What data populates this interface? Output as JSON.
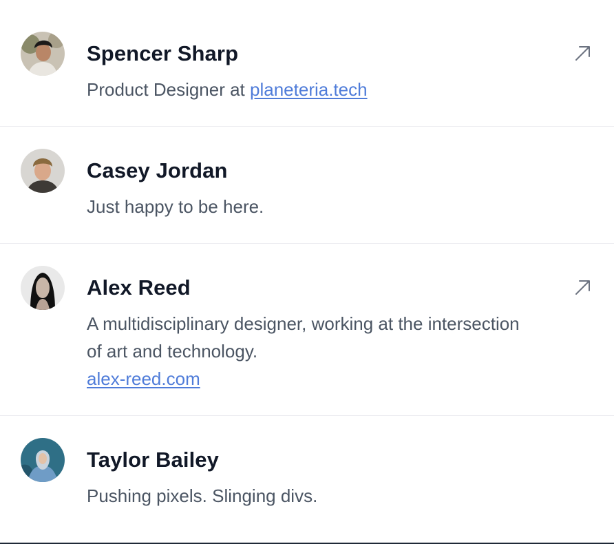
{
  "people": [
    {
      "name": "Spencer Sharp",
      "bio_prefix": "Product Designer at ",
      "bio_link": "planeteria.tech",
      "avatar_icon": "avatar-spencer",
      "has_external_link": true
    },
    {
      "name": "Casey Jordan",
      "bio": "Just happy to be here.",
      "avatar_icon": "avatar-casey",
      "has_external_link": false
    },
    {
      "name": "Alex Reed",
      "bio": "A multidisciplinary designer, working at the intersection of art and technology.",
      "bio_link": "alex-reed.com",
      "avatar_icon": "avatar-alex",
      "has_external_link": true
    },
    {
      "name": "Taylor Bailey",
      "bio": "Pushing pixels. Slinging divs.",
      "avatar_icon": "avatar-taylor",
      "has_external_link": false
    }
  ],
  "colors": {
    "name": "#111827",
    "bio": "#4b5563",
    "link": "#4f7cd9",
    "divider": "#ececf0",
    "icon": "#6b7280"
  },
  "icons": {
    "external_link": "arrow-up-right-icon"
  }
}
